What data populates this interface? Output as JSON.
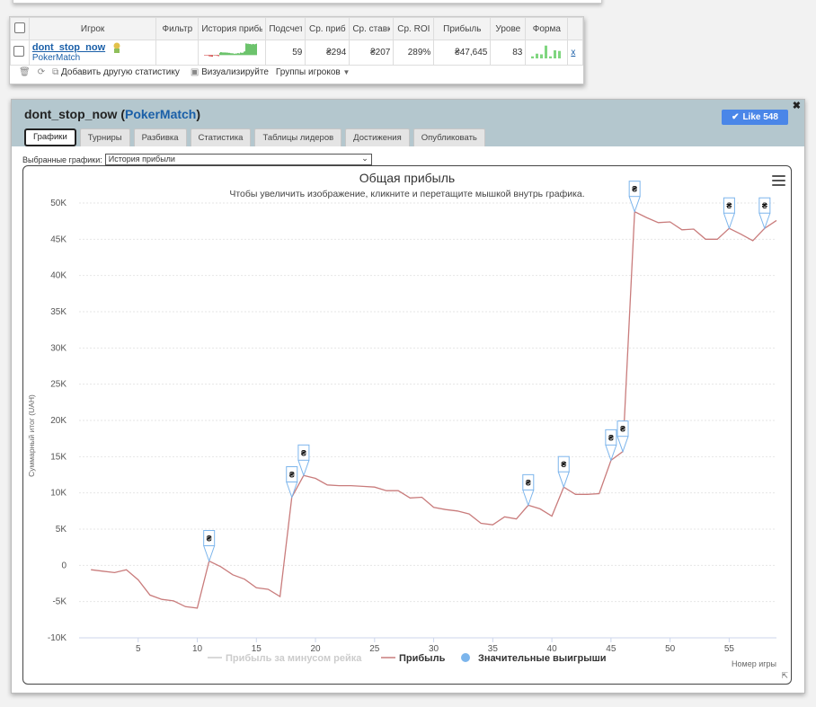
{
  "stats_table": {
    "headers": [
      "Игрок",
      "Фильтр",
      "История прибы",
      "Подсчет",
      "Ср. приб",
      "Ср. ставк",
      "Ср. ROI",
      "Прибыль",
      "Урове",
      "Форма"
    ],
    "row": {
      "player_name": "dont_stop_now",
      "site": "PokerMatch",
      "filter": "",
      "count": "59",
      "avg_profit": "₴294",
      "avg_stake": "₴207",
      "avg_roi": "289%",
      "profit": "₴47,645",
      "level": "83",
      "remove": "x"
    },
    "form_bars": [
      0.15,
      0.35,
      0.3,
      0.95,
      0.15,
      0.6,
      0.55
    ],
    "toolbar": {
      "add_stat": "Добавить другую статистику",
      "visualize": "Визуализируйте",
      "groups": "Группы игроков"
    }
  },
  "panel": {
    "player": "dont_stop_now",
    "site": "PokerMatch",
    "like_label": "Like 548",
    "tabs": [
      "Графики",
      "Турниры",
      "Разбивка",
      "Статистика",
      "Таблицы лидеров",
      "Достижения",
      "Опубликовать"
    ],
    "active_tab": 0,
    "selected_label": "Выбранные графики:",
    "selected_value": "История прибыли"
  },
  "chart_data": {
    "type": "line",
    "title": "Общая прибыль",
    "subtitle": "Чтобы увеличить изображение, кликните и перетащите мышкой внутрь графика.",
    "xlabel": "Номер игры",
    "ylabel": "Суммарный итог (UAH)",
    "xlim": [
      0,
      59
    ],
    "ylim": [
      -10000,
      50000
    ],
    "x_ticks": [
      5,
      10,
      15,
      20,
      25,
      30,
      35,
      40,
      45,
      50,
      55
    ],
    "y_ticks": [
      -10000,
      -5000,
      0,
      5000,
      10000,
      15000,
      20000,
      25000,
      30000,
      35000,
      40000,
      45000,
      50000
    ],
    "y_tick_labels": [
      "-10K",
      "-5K",
      "0",
      "5K",
      "10K",
      "15K",
      "20K",
      "25K",
      "30K",
      "35K",
      "40K",
      "45K",
      "50K"
    ],
    "grid": true,
    "legend": [
      {
        "name": "Прибыль за минусом рейка",
        "color": "#cccccc",
        "disabled": true
      },
      {
        "name": "Прибыль",
        "color": "#c97c7c"
      },
      {
        "name": "Значительные выигрыши",
        "color": "#7cb5ec"
      }
    ],
    "series": [
      {
        "name": "Прибыль",
        "color": "#c97c7c",
        "x": [
          1,
          2,
          3,
          4,
          5,
          6,
          7,
          8,
          9,
          10,
          11,
          12,
          13,
          14,
          15,
          16,
          17,
          18,
          19,
          20,
          21,
          22,
          23,
          24,
          25,
          26,
          27,
          28,
          29,
          30,
          31,
          32,
          33,
          34,
          35,
          36,
          37,
          38,
          39,
          40,
          41,
          42,
          43,
          44,
          45,
          46,
          47,
          48,
          49,
          50,
          51,
          52,
          53,
          54,
          55,
          56,
          57,
          58,
          59
        ],
        "y": [
          -600,
          -800,
          -1000,
          -600,
          -2000,
          -4100,
          -4700,
          -4900,
          -5700,
          -5900,
          600,
          -200,
          -1300,
          -1900,
          -3100,
          -3300,
          -4300,
          9400,
          12400,
          12000,
          11100,
          11000,
          11000,
          10900,
          10800,
          10300,
          10300,
          9300,
          9400,
          8000,
          7700,
          7500,
          7100,
          5800,
          5600,
          6700,
          6400,
          8300,
          7800,
          6800,
          10800,
          9800,
          9800,
          9900,
          14500,
          15700,
          48800,
          48000,
          47300,
          47400,
          46300,
          46400,
          45000,
          45000,
          46500,
          45700,
          44800,
          46500,
          47600
        ]
      }
    ],
    "markers": [
      {
        "x": 11,
        "y": 600,
        "label": "₴"
      },
      {
        "x": 18,
        "y": 9400,
        "label": "₴"
      },
      {
        "x": 19,
        "y": 12400,
        "label": "₴"
      },
      {
        "x": 38,
        "y": 8300,
        "label": "₴"
      },
      {
        "x": 41,
        "y": 10800,
        "label": "₴"
      },
      {
        "x": 45,
        "y": 14500,
        "label": "₴"
      },
      {
        "x": 46,
        "y": 15700,
        "label": "₴"
      },
      {
        "x": 47,
        "y": 48800,
        "label": "₴"
      },
      {
        "x": 55,
        "y": 46500,
        "label": "₴"
      },
      {
        "x": 58,
        "y": 46500,
        "label": "₴"
      }
    ]
  }
}
